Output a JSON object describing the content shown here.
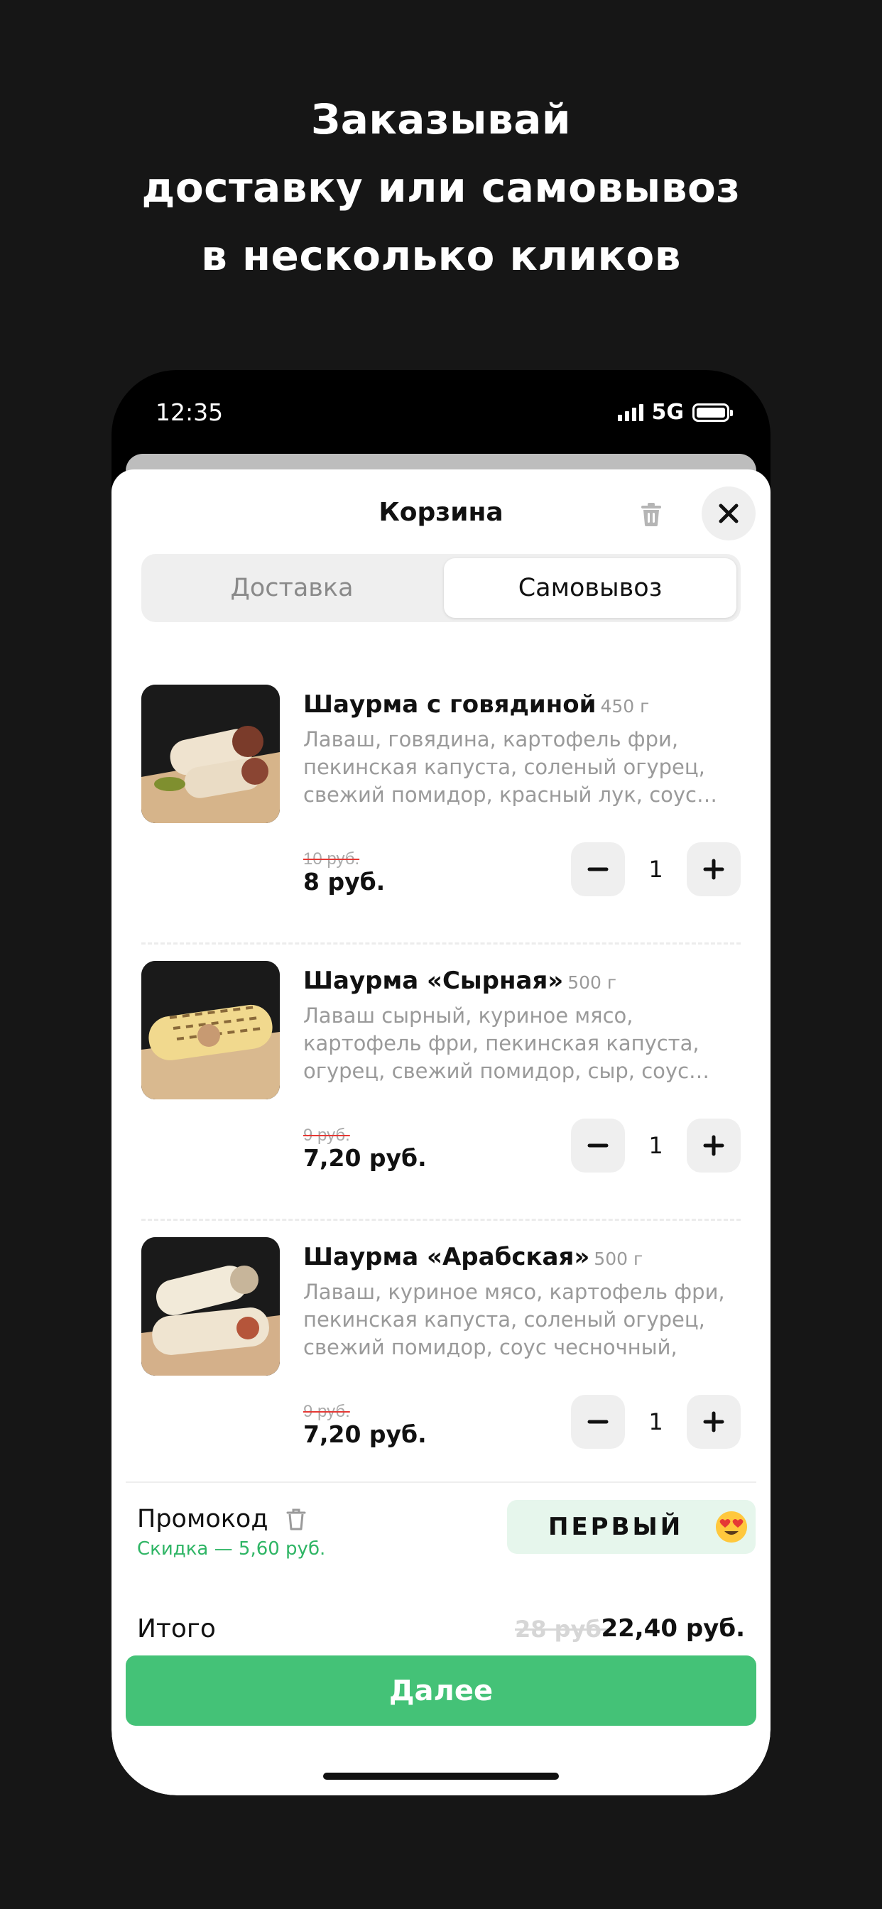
{
  "promo_headline": {
    "line1": "Заказывай",
    "line2": "доставку или самовывоз",
    "line3": "в несколько кликов"
  },
  "status_bar": {
    "time": "12:35",
    "network": "5G"
  },
  "cart": {
    "title": "Корзина",
    "tabs": [
      {
        "label": "Доставка",
        "selected": false
      },
      {
        "label": "Самовывоз",
        "selected": true
      }
    ],
    "items": [
      {
        "name": "Шаурма с говядиной",
        "weight": "450 г",
        "description": "Лаваш, говядина, картофель фри, пекинская капуста, соленый огурец, свежий помидор, красный лук, соус…",
        "old_price": "10 руб.",
        "price": "8 руб.",
        "quantity": "1"
      },
      {
        "name": "Шаурма «Сырная»",
        "weight": "500 г",
        "description": "Лаваш сырный, куриное мясо, картофель фри, пекинская капуста, огурец, свежий помидор, сыр, соус…",
        "old_price": "9 руб.",
        "price": "7,20 руб.",
        "quantity": "1"
      },
      {
        "name": "Шаурма «Арабская»",
        "weight": "500 г",
        "description": "Лаваш, куриное мясо, картофель фри, пекинская капуста, соленый огурец, свежий помидор, соус чесночный, соу…",
        "old_price": "9 руб.",
        "price": "7,20 руб.",
        "quantity": "1"
      }
    ],
    "promo": {
      "label": "Промокод",
      "discount": "Скидка — 5,60 руб.",
      "code": "ПЕРВЫЙ"
    },
    "total": {
      "label": "Итого",
      "old": "28 руб.",
      "new": "22,40 руб."
    },
    "next_button": "Далее"
  },
  "colors": {
    "accent_green": "#44c277",
    "discount_green": "#2fb565",
    "background": "#161616"
  }
}
